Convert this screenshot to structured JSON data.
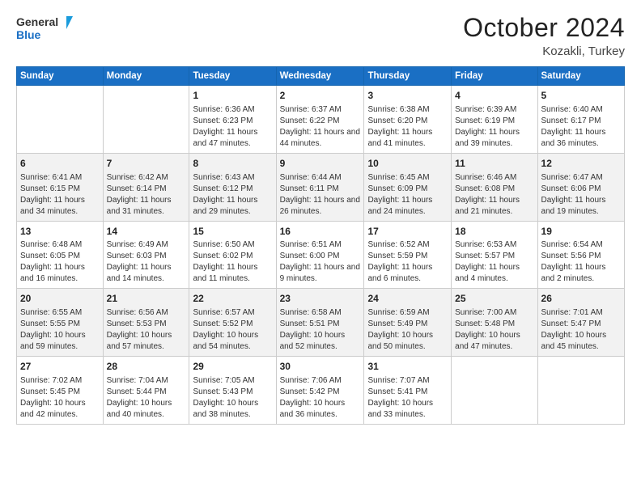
{
  "header": {
    "logo_line1": "General",
    "logo_line2": "Blue",
    "main_title": "October 2024",
    "subtitle": "Kozakli, Turkey"
  },
  "days_of_week": [
    "Sunday",
    "Monday",
    "Tuesday",
    "Wednesday",
    "Thursday",
    "Friday",
    "Saturday"
  ],
  "weeks": [
    [
      {
        "day": "",
        "info": ""
      },
      {
        "day": "",
        "info": ""
      },
      {
        "day": "1",
        "info": "Sunrise: 6:36 AM\nSunset: 6:23 PM\nDaylight: 11 hours and 47 minutes."
      },
      {
        "day": "2",
        "info": "Sunrise: 6:37 AM\nSunset: 6:22 PM\nDaylight: 11 hours and 44 minutes."
      },
      {
        "day": "3",
        "info": "Sunrise: 6:38 AM\nSunset: 6:20 PM\nDaylight: 11 hours and 41 minutes."
      },
      {
        "day": "4",
        "info": "Sunrise: 6:39 AM\nSunset: 6:19 PM\nDaylight: 11 hours and 39 minutes."
      },
      {
        "day": "5",
        "info": "Sunrise: 6:40 AM\nSunset: 6:17 PM\nDaylight: 11 hours and 36 minutes."
      }
    ],
    [
      {
        "day": "6",
        "info": "Sunrise: 6:41 AM\nSunset: 6:15 PM\nDaylight: 11 hours and 34 minutes."
      },
      {
        "day": "7",
        "info": "Sunrise: 6:42 AM\nSunset: 6:14 PM\nDaylight: 11 hours and 31 minutes."
      },
      {
        "day": "8",
        "info": "Sunrise: 6:43 AM\nSunset: 6:12 PM\nDaylight: 11 hours and 29 minutes."
      },
      {
        "day": "9",
        "info": "Sunrise: 6:44 AM\nSunset: 6:11 PM\nDaylight: 11 hours and 26 minutes."
      },
      {
        "day": "10",
        "info": "Sunrise: 6:45 AM\nSunset: 6:09 PM\nDaylight: 11 hours and 24 minutes."
      },
      {
        "day": "11",
        "info": "Sunrise: 6:46 AM\nSunset: 6:08 PM\nDaylight: 11 hours and 21 minutes."
      },
      {
        "day": "12",
        "info": "Sunrise: 6:47 AM\nSunset: 6:06 PM\nDaylight: 11 hours and 19 minutes."
      }
    ],
    [
      {
        "day": "13",
        "info": "Sunrise: 6:48 AM\nSunset: 6:05 PM\nDaylight: 11 hours and 16 minutes."
      },
      {
        "day": "14",
        "info": "Sunrise: 6:49 AM\nSunset: 6:03 PM\nDaylight: 11 hours and 14 minutes."
      },
      {
        "day": "15",
        "info": "Sunrise: 6:50 AM\nSunset: 6:02 PM\nDaylight: 11 hours and 11 minutes."
      },
      {
        "day": "16",
        "info": "Sunrise: 6:51 AM\nSunset: 6:00 PM\nDaylight: 11 hours and 9 minutes."
      },
      {
        "day": "17",
        "info": "Sunrise: 6:52 AM\nSunset: 5:59 PM\nDaylight: 11 hours and 6 minutes."
      },
      {
        "day": "18",
        "info": "Sunrise: 6:53 AM\nSunset: 5:57 PM\nDaylight: 11 hours and 4 minutes."
      },
      {
        "day": "19",
        "info": "Sunrise: 6:54 AM\nSunset: 5:56 PM\nDaylight: 11 hours and 2 minutes."
      }
    ],
    [
      {
        "day": "20",
        "info": "Sunrise: 6:55 AM\nSunset: 5:55 PM\nDaylight: 10 hours and 59 minutes."
      },
      {
        "day": "21",
        "info": "Sunrise: 6:56 AM\nSunset: 5:53 PM\nDaylight: 10 hours and 57 minutes."
      },
      {
        "day": "22",
        "info": "Sunrise: 6:57 AM\nSunset: 5:52 PM\nDaylight: 10 hours and 54 minutes."
      },
      {
        "day": "23",
        "info": "Sunrise: 6:58 AM\nSunset: 5:51 PM\nDaylight: 10 hours and 52 minutes."
      },
      {
        "day": "24",
        "info": "Sunrise: 6:59 AM\nSunset: 5:49 PM\nDaylight: 10 hours and 50 minutes."
      },
      {
        "day": "25",
        "info": "Sunrise: 7:00 AM\nSunset: 5:48 PM\nDaylight: 10 hours and 47 minutes."
      },
      {
        "day": "26",
        "info": "Sunrise: 7:01 AM\nSunset: 5:47 PM\nDaylight: 10 hours and 45 minutes."
      }
    ],
    [
      {
        "day": "27",
        "info": "Sunrise: 7:02 AM\nSunset: 5:45 PM\nDaylight: 10 hours and 42 minutes."
      },
      {
        "day": "28",
        "info": "Sunrise: 7:04 AM\nSunset: 5:44 PM\nDaylight: 10 hours and 40 minutes."
      },
      {
        "day": "29",
        "info": "Sunrise: 7:05 AM\nSunset: 5:43 PM\nDaylight: 10 hours and 38 minutes."
      },
      {
        "day": "30",
        "info": "Sunrise: 7:06 AM\nSunset: 5:42 PM\nDaylight: 10 hours and 36 minutes."
      },
      {
        "day": "31",
        "info": "Sunrise: 7:07 AM\nSunset: 5:41 PM\nDaylight: 10 hours and 33 minutes."
      },
      {
        "day": "",
        "info": ""
      },
      {
        "day": "",
        "info": ""
      }
    ]
  ]
}
